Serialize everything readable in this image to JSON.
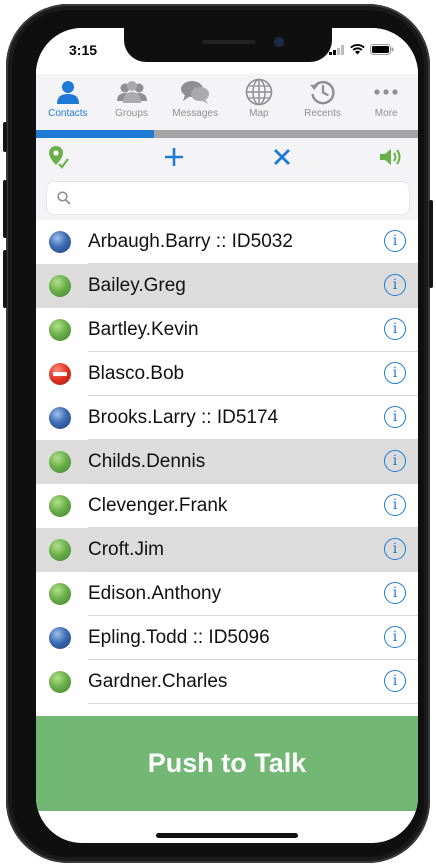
{
  "status_bar": {
    "time": "3:15"
  },
  "tabs": [
    {
      "label": "Contacts",
      "icon": "person-icon",
      "active": true
    },
    {
      "label": "Groups",
      "icon": "group-icon",
      "active": false
    },
    {
      "label": "Messages",
      "icon": "chat-bubbles-icon",
      "active": false
    },
    {
      "label": "Map",
      "icon": "globe-icon",
      "active": false
    },
    {
      "label": "Recents",
      "icon": "history-icon",
      "active": false
    },
    {
      "label": "More",
      "icon": "ellipsis-icon",
      "active": false
    }
  ],
  "toolbar": {
    "icons": [
      "location-pin-icon",
      "add-icon",
      "close-icon",
      "speaker-icon"
    ],
    "accent_green": "#6ab04a",
    "accent_blue": "#1f7ad6"
  },
  "search": {
    "placeholder": ""
  },
  "contacts": [
    {
      "name": "Arbaugh.Barry :: ID5032",
      "status": "away",
      "highlighted": false
    },
    {
      "name": "Bailey.Greg",
      "status": "online",
      "highlighted": true
    },
    {
      "name": "Bartley.Kevin",
      "status": "online",
      "highlighted": false
    },
    {
      "name": "Blasco.Bob",
      "status": "dnd",
      "highlighted": false
    },
    {
      "name": "Brooks.Larry :: ID5174",
      "status": "away",
      "highlighted": false
    },
    {
      "name": "Childs.Dennis",
      "status": "online",
      "highlighted": true
    },
    {
      "name": "Clevenger.Frank",
      "status": "online",
      "highlighted": false
    },
    {
      "name": "Croft.Jim",
      "status": "online",
      "highlighted": true
    },
    {
      "name": "Edison.Anthony",
      "status": "online",
      "highlighted": false
    },
    {
      "name": "Epling.Todd :: ID5096",
      "status": "away",
      "highlighted": false
    },
    {
      "name": "Gardner.Charles",
      "status": "online",
      "highlighted": false
    }
  ],
  "push_to_talk": {
    "label": "Push to Talk",
    "color": "#72b874"
  },
  "colors": {
    "tab_active": "#1f7ad6",
    "row_highlight": "#dcdcdd"
  }
}
